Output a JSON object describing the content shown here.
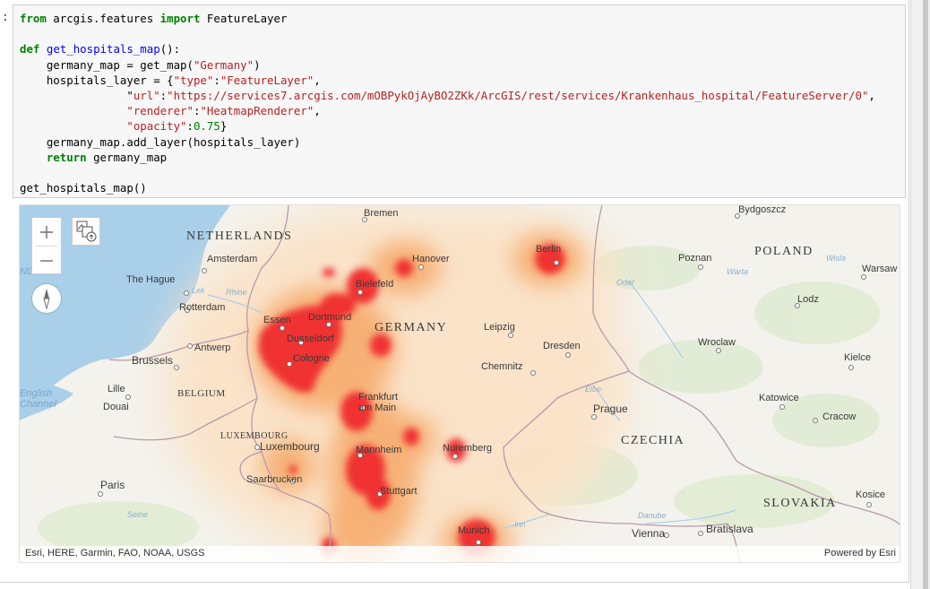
{
  "notebook": {
    "prompt": ":",
    "code_lines": [
      [
        {
          "t": "from",
          "c": "kw"
        },
        {
          "t": " arcgis.features "
        },
        {
          "t": "import",
          "c": "kw"
        },
        {
          "t": " FeatureLayer"
        }
      ],
      [],
      [
        {
          "t": "def",
          "c": "kw"
        },
        {
          "t": " "
        },
        {
          "t": "get_hospitals_map",
          "c": "fn"
        },
        {
          "t": "():"
        }
      ],
      [
        {
          "t": "    germany_map = get_map("
        },
        {
          "t": "\"Germany\"",
          "c": "st"
        },
        {
          "t": ")"
        }
      ],
      [
        {
          "t": "    hospitals_layer = {"
        },
        {
          "t": "\"type\"",
          "c": "st"
        },
        {
          "t": ":"
        },
        {
          "t": "\"FeatureLayer\"",
          "c": "st"
        },
        {
          "t": ","
        }
      ],
      [
        {
          "t": "                \""
        },
        {
          "t": "url\"",
          "c": "st"
        },
        {
          "t": ":"
        },
        {
          "t": "\"https://services7.arcgis.com/mOBPykOjAyBO2ZKk/ArcGIS/rest/services/Krankenhaus_hospital/FeatureServer/0\"",
          "c": "st"
        },
        {
          "t": ","
        }
      ],
      [
        {
          "t": "                "
        },
        {
          "t": "\"renderer\"",
          "c": "st"
        },
        {
          "t": ":"
        },
        {
          "t": "\"HeatmapRenderer\"",
          "c": "st"
        },
        {
          "t": ","
        }
      ],
      [
        {
          "t": "                "
        },
        {
          "t": "\"opacity\"",
          "c": "st"
        },
        {
          "t": ":"
        },
        {
          "t": "0.75",
          "c": "nm"
        },
        {
          "t": "}"
        }
      ],
      [
        {
          "t": "    germany_map.add_layer(hospitals_layer)"
        }
      ],
      [
        {
          "t": "    "
        },
        {
          "t": "return",
          "c": "kw"
        },
        {
          "t": " germany_map"
        }
      ],
      [],
      [
        {
          "t": "get_hospitals_map()"
        }
      ]
    ]
  },
  "map": {
    "attribution": "Esri, HERE, Garmin, FAO, NOAA, USGS",
    "powered_by": "Powered by Esri",
    "renderer": "HeatmapRenderer",
    "opacity": 0.75,
    "controls": {
      "zoom_in_icon": "plus-icon",
      "zoom_out_icon": "minus-icon",
      "layers_icon": "basemap-layers-icon",
      "compass_icon": "compass-icon"
    },
    "countries": [
      "NETHERLANDS",
      "GERMANY",
      "POLAND",
      "BELGIUM",
      "LUXEMBOURG",
      "CZECHIA",
      "SLOVAKIA"
    ],
    "cities": [
      "Bremen",
      "Bydgoszcz",
      "Hanover",
      "Berlin",
      "Amsterdam",
      "Poznan",
      "Warsaw",
      "The Hague",
      "Bielefeld",
      "Lodz",
      "Rotterdam",
      "Essen",
      "Dortmund",
      "Dusseldorf",
      "Leipzig",
      "Antwerp",
      "Dresden",
      "Wroclaw",
      "Brussels",
      "Cologne",
      "Chemnitz",
      "Kielce",
      "Lille",
      "Frankfurt am Main",
      "Katowice",
      "Douai",
      "Prague",
      "Cracow",
      "Luxembourg",
      "Nuremberg",
      "Mannheim",
      "Saarbrucken",
      "Paris",
      "Stuttgart",
      "Kosice",
      "Vienna",
      "Bratislava",
      "Munich"
    ],
    "water": [
      "English Channel",
      "Lek",
      "Rhine",
      "Oder",
      "Warta",
      "Wisla",
      "Elbe",
      "Seine",
      "Danube",
      "Inn"
    ],
    "heat_colors": {
      "hot": "#f03232",
      "warm": "#f5a05a",
      "cool": "#fbe3c8",
      "ocean": "#a9cfe9",
      "land": "#f3f2ec"
    }
  }
}
